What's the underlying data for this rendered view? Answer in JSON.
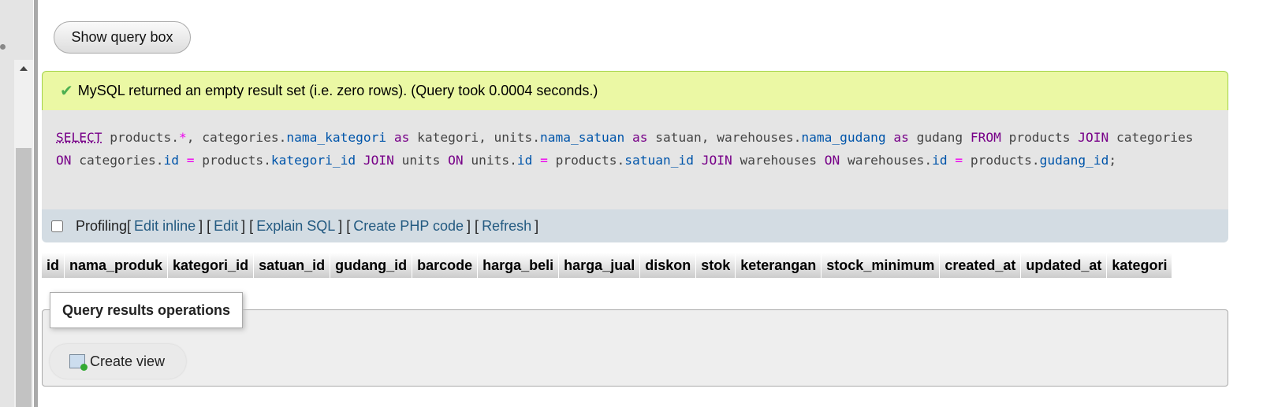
{
  "show_query_box": "Show query box",
  "success_message": "MySQL returned an empty result set (i.e. zero rows). (Query took 0.0004 seconds.)",
  "sql_tokens": [
    {
      "t": "SELECT",
      "c": "k kw0"
    },
    {
      "t": " products."
    },
    {
      "t": "*",
      "c": "o"
    },
    {
      "t": ", categories."
    },
    {
      "t": "nama_kategori",
      "c": "c"
    },
    {
      "t": " "
    },
    {
      "t": "as",
      "c": "k"
    },
    {
      "t": " kategori, units."
    },
    {
      "t": "nama_satuan",
      "c": "c"
    },
    {
      "t": " "
    },
    {
      "t": "as",
      "c": "k"
    },
    {
      "t": " satuan, warehouses."
    },
    {
      "t": "nama_gudang",
      "c": "c"
    },
    {
      "t": " "
    },
    {
      "t": "as",
      "c": "k"
    },
    {
      "t": " gudang "
    },
    {
      "t": "FROM",
      "c": "k"
    },
    {
      "t": " products "
    },
    {
      "t": "JOIN",
      "c": "k"
    },
    {
      "t": " categories "
    },
    {
      "t": "ON",
      "c": "k"
    },
    {
      "t": " categories."
    },
    {
      "t": "id",
      "c": "c"
    },
    {
      "t": " "
    },
    {
      "t": "=",
      "c": "o"
    },
    {
      "t": " products."
    },
    {
      "t": "kategori_id",
      "c": "c"
    },
    {
      "t": " "
    },
    {
      "t": "JOIN",
      "c": "k"
    },
    {
      "t": " units "
    },
    {
      "t": "ON",
      "c": "k"
    },
    {
      "t": " units."
    },
    {
      "t": "id",
      "c": "c"
    },
    {
      "t": " "
    },
    {
      "t": "=",
      "c": "o"
    },
    {
      "t": " products."
    },
    {
      "t": "satuan_id",
      "c": "c"
    },
    {
      "t": " "
    },
    {
      "t": "JOIN",
      "c": "k"
    },
    {
      "t": " warehouses "
    },
    {
      "t": "ON",
      "c": "k"
    },
    {
      "t": " warehouses."
    },
    {
      "t": "id",
      "c": "c"
    },
    {
      "t": " "
    },
    {
      "t": "=",
      "c": "o"
    },
    {
      "t": " products."
    },
    {
      "t": "gudang_id",
      "c": "c"
    },
    {
      "t": ";"
    }
  ],
  "tools": {
    "profiling": "Profiling",
    "links": [
      "Edit inline",
      "Edit",
      "Explain SQL",
      "Create PHP code",
      "Refresh"
    ]
  },
  "columns": [
    "id",
    "nama_produk",
    "kategori_id",
    "satuan_id",
    "gudang_id",
    "barcode",
    "harga_beli",
    "harga_jual",
    "diskon",
    "stok",
    "keterangan",
    "stock_minimum",
    "created_at",
    "updated_at",
    "kategori"
  ],
  "operations": {
    "title": "Query results operations",
    "create_view": "Create view"
  }
}
